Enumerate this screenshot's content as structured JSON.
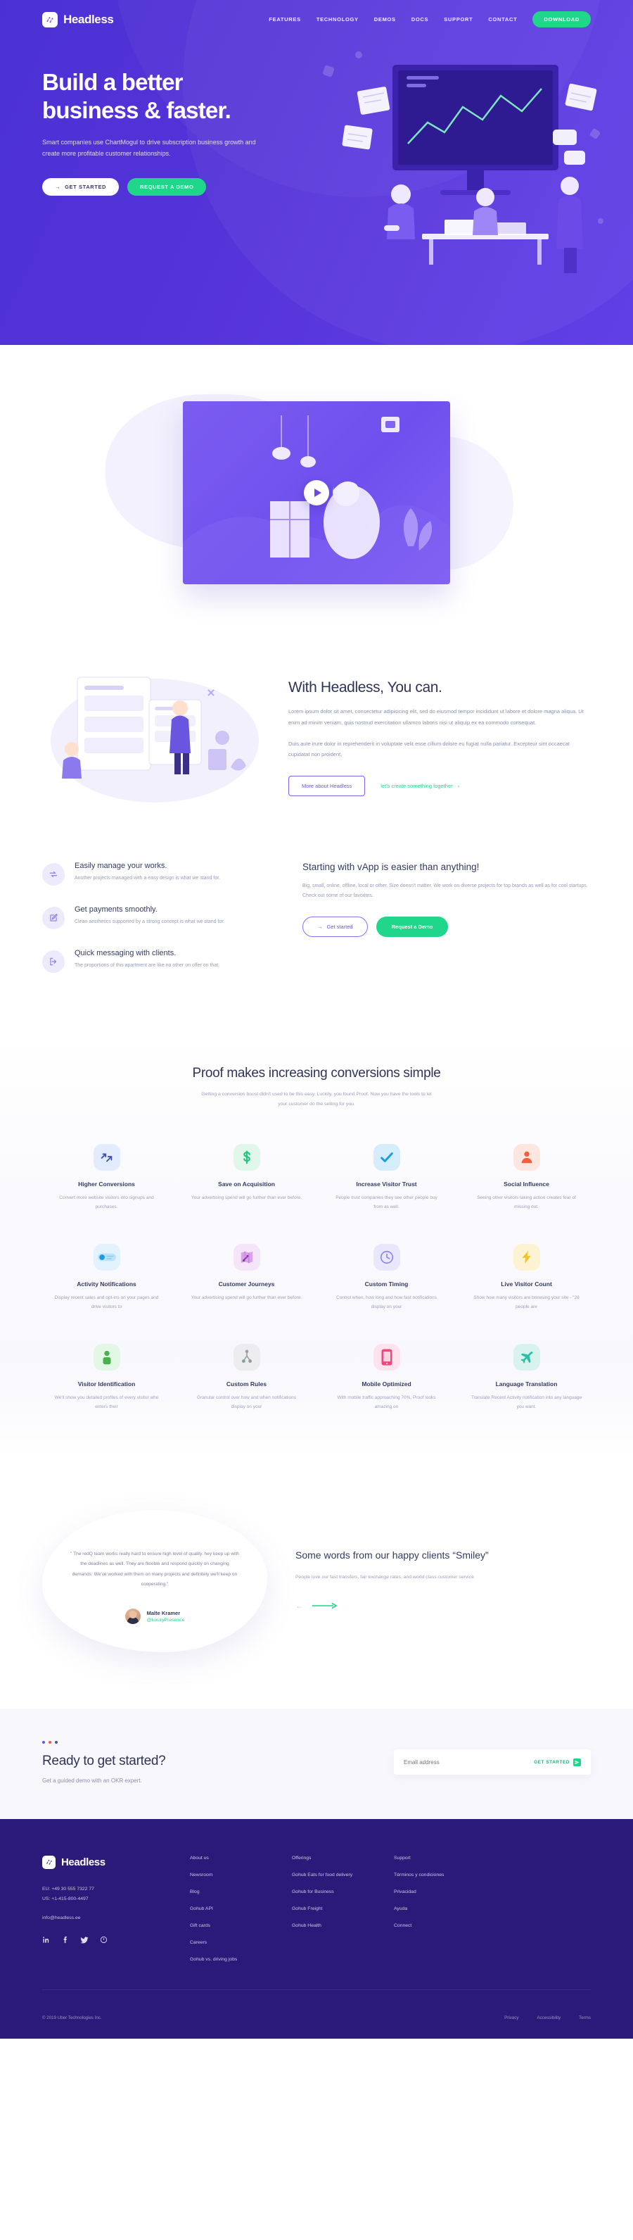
{
  "brand": {
    "name": "Headless",
    "logo_icon": "headless-logo-icon"
  },
  "nav": {
    "links": [
      "FEATURES",
      "TECHNOLOGY",
      "DEMOS",
      "DOCS",
      "SUPPORT",
      "CONTACT"
    ],
    "cta_label": "DOWNLOAD"
  },
  "hero": {
    "title_line1": "Build a better",
    "title_line2": "business & faster.",
    "subtitle": "Smart companies use ChartMogul to drive subscription business growth and create more profitable customer relationships.",
    "btn_primary": "GET STARTED",
    "btn_secondary": "REQUEST A DEMO",
    "bg_color": "#5433d8",
    "accent_green": "#1fd68b"
  },
  "video": {
    "play_icon": "play-icon"
  },
  "with_headless": {
    "title": "With Headless, You can.",
    "para1": "Lorem ipsum dolor sit amet, consectetur adipisicing elit, sed do eiusmod tempor incididunt ut labore et dolore magna aliqua. Ut enim ad minim veniam, quis nostrud exercitation ullamco laboris nisi ut aliquip ex ea commodo consequat.",
    "para2": "Duis aute irure dolor in reprehenderit in voluptate velit esse cillum dolore eu fugiat nulla pariatur. Excepteur sint occaecat cupidatat non proident,",
    "btn_label": "More about Headless",
    "link_label": "let's create something together"
  },
  "features_list": [
    {
      "icon": "refresh-cycle-icon",
      "title": "Easily manage your works.",
      "desc": "Another projects managed with a easy design is what we stand for."
    },
    {
      "icon": "edit-square-icon",
      "title": "Get payments smoothly.",
      "desc": "Clean aesthetics supported by a strong concept is what we stand for."
    },
    {
      "icon": "logout-arrow-icon",
      "title": "Quick messaging with clients.",
      "desc": "The proportions of this apartment are like no other on offer on that."
    }
  ],
  "vapp": {
    "title": "Starting with vApp is easier than anything!",
    "desc": "Big, small, online, offline, local or other. Size doesn't matter. We work on diverse projects for top brands as well as for cool startups. Check out some of our favorites.",
    "btn_outline": "Get started",
    "btn_green": "Request a Demo"
  },
  "proof": {
    "title": "Proof makes increasing conversions simple",
    "subtitle": "Getting a conversion boost didn't used to be this easy. Luckily, you found Proof. Now you have the tools to let your customer do the selling for you.",
    "cards": [
      {
        "icon": "arrows-up-right-icon",
        "icon_bg": "#e3ecfd",
        "icon_color": "#3f51b5",
        "title": "Higher Conversions",
        "desc": "Convert more website visitors into signups and purchases."
      },
      {
        "icon": "dollar-sign-icon",
        "icon_bg": "#e2f7ec",
        "icon_color": "#21c47a",
        "title": "Save on Acquisition",
        "desc": "Your advertising spend will go further than ever before."
      },
      {
        "icon": "check-mark-icon",
        "icon_bg": "#d5ecfb",
        "icon_color": "#1a9de0",
        "title": "Increase Visitor Trust",
        "desc": "People trust companies they see other people buy from as well."
      },
      {
        "icon": "user-silhouette-icon",
        "icon_bg": "#fde5e0",
        "icon_color": "#f0603c",
        "title": "Social Influence",
        "desc": "Seeing other visitors taking action creates fear of missing out."
      },
      {
        "icon": "notification-pill-icon",
        "icon_bg": "#e3f3fd",
        "icon_color": "#1a9de0",
        "title": "Activity Notifications",
        "desc": "Display recent sales and opt-ins on your pages and drive visitors to"
      },
      {
        "icon": "journey-map-icon",
        "icon_bg": "#f6e4f9",
        "icon_color": "#b15fd6",
        "title": "Customer Journeys",
        "desc": "Your advertising spend will go further than ever before."
      },
      {
        "icon": "clock-icon",
        "icon_bg": "#e9e7fb",
        "icon_color": "#8f86e8",
        "title": "Custom Timing",
        "desc": "Control when, how long and how fast notifications display on your"
      },
      {
        "icon": "lightning-bolt-icon",
        "icon_bg": "#fdf3d2",
        "icon_color": "#f7c324",
        "title": "Live Visitor Count",
        "desc": "Show how many visitors are browsing your site - \"28 people are"
      },
      {
        "icon": "person-badge-icon",
        "icon_bg": "#e3f7e6",
        "icon_color": "#4caf50",
        "title": "Visitor Identification",
        "desc": "We'll show you detailed profiles of every visitor who enters their"
      },
      {
        "icon": "branch-rules-icon",
        "icon_bg": "#ededf0",
        "icon_color": "#9aa0a8",
        "title": "Custom Rules",
        "desc": "Granular control over how and when notifications display on your"
      },
      {
        "icon": "mobile-phone-icon",
        "icon_bg": "#fde3ee",
        "icon_color": "#f0477f",
        "title": "Mobile Optimized",
        "desc": "With mobile traffic approaching 70%, Proof looks amazing on"
      },
      {
        "icon": "airplane-icon",
        "icon_bg": "#d8f3ee",
        "icon_color": "#2bbfa6",
        "title": "Language Translation",
        "desc": "Translate Recent Activity notification into any language you want."
      }
    ]
  },
  "testimonial": {
    "quote": "\" The redQ team works really hard to ensure high level of quality. hey keep up with the deadlines as well. They are flexible and respond quickly on changing demands. We've worked with them on many projects and definitely we'll keep on cooperating.\"",
    "author_name": "Malte Kramer",
    "author_handle": "@luxuryPresence",
    "heading": "Some words from our happy clients “Smiley”",
    "sub": "People love our fast transfers, fair exchange rates, and world class customer service",
    "prev_icon": "arrow-left-icon",
    "next_icon": "arrow-right-icon"
  },
  "cta": {
    "heading": "Ready to get started?",
    "sub": "Get a guided demo with an OKR expert.",
    "input_placeholder": "Email address",
    "submit_label": "GET STARTED",
    "submit_icon": "send-icon",
    "dots": [
      "#6a55e0",
      "#f0603c",
      "#3f51b5"
    ]
  },
  "footer": {
    "brand": "Headless",
    "phone_eu": "EU: +49 30 555 7322 77",
    "phone_us": "US: +1-415-800-4497",
    "email": "info@headless.ee",
    "socials": [
      "linkedin-icon",
      "facebook-icon",
      "twitter-icon",
      "github-icon"
    ],
    "columns": [
      {
        "items": [
          "About us",
          "Newsroom",
          "Blog",
          "Gohub API",
          "Gift cards",
          "Careers",
          "Gohub vs. driving jobs"
        ]
      },
      {
        "items": [
          "Offerings",
          "Gohub Eats for food delivery",
          "Gohub for Business",
          "Gohub Freight",
          "Gohub Health"
        ]
      },
      {
        "items": [
          "Support",
          "Términos y condiciones",
          "Privacidad",
          "Ayuda",
          "Connect"
        ]
      }
    ],
    "copyright": "© 2019 Uber Technologies Inc.",
    "legal": [
      "Privacy",
      "Accessibility",
      "Terms"
    ],
    "bg_color": "#2b1a7a"
  }
}
